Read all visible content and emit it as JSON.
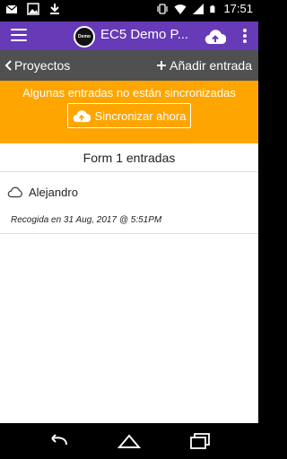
{
  "status": {
    "time": "17:51",
    "left_icons": [
      "mail-icon",
      "image-icon",
      "download-icon"
    ],
    "right_icons": [
      "vibrate-icon",
      "wifi-icon",
      "signal-icon",
      "battery-icon"
    ]
  },
  "appbar": {
    "title": "EC5 Demo P...",
    "logo_text": "Demo",
    "colors": {
      "appbar": "#673ab7"
    }
  },
  "subbar": {
    "back_label": "Proyectos",
    "add_label": "Añadir entrada"
  },
  "banner": {
    "message": "Algunas entradas no están sincronizadas",
    "sync_label": "Sincronizar ahora",
    "color": "#ffa500"
  },
  "list": {
    "header": "Form 1 entradas",
    "entries": [
      {
        "name": "Alejandro",
        "collected": "Recogida en 31 Aug, 2017 @ 5:51PM"
      }
    ]
  }
}
